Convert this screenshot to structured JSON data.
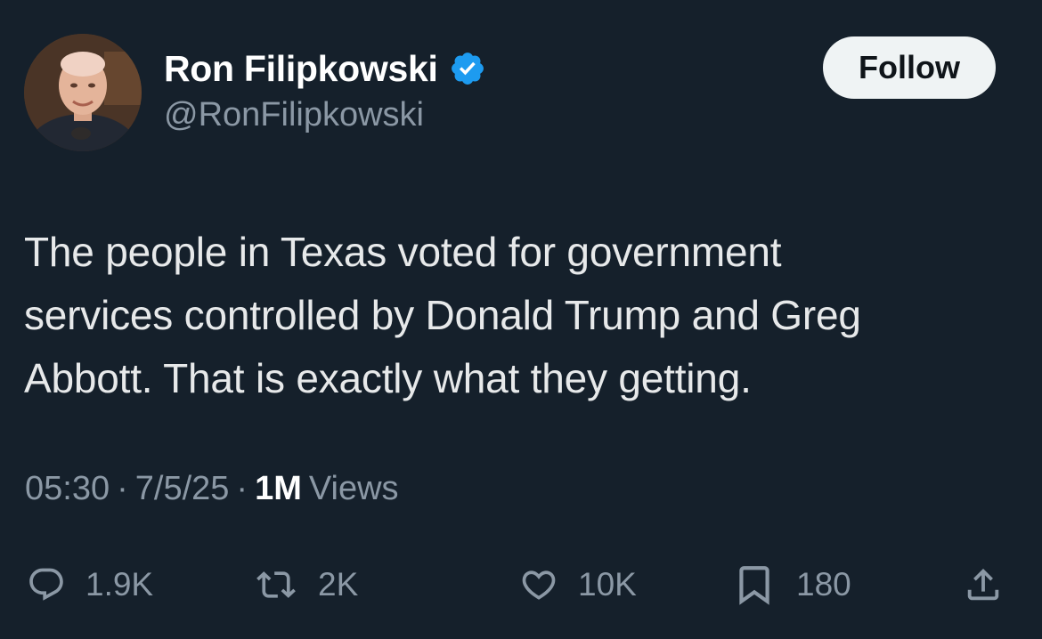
{
  "author": {
    "display_name": "Ron Filipkowski",
    "handle": "@RonFilipkowski",
    "verified_icon": "verified-badge-icon",
    "follow_label": "Follow"
  },
  "tweet": {
    "lines": [
      "The people in Texas voted for government",
      "services controlled by Donald Trump and Greg",
      "Abbott. That is exactly what they getting."
    ],
    "time": "05:30",
    "separator": "·",
    "date": "7/5/25",
    "views_count": "1M",
    "views_label": "Views"
  },
  "actions": {
    "reply": {
      "icon": "reply-icon",
      "count": "1.9K"
    },
    "repost": {
      "icon": "repost-icon",
      "count": "2K"
    },
    "like": {
      "icon": "heart-icon",
      "count": "10K"
    },
    "bookmark": {
      "icon": "bookmark-icon",
      "count": "180"
    },
    "share": {
      "icon": "share-icon"
    }
  },
  "colors": {
    "background": "#15202b",
    "text": "#e7e9ea",
    "muted": "#8b98a5",
    "verified": "#1d9bf0",
    "follow_bg": "#eff3f4"
  }
}
